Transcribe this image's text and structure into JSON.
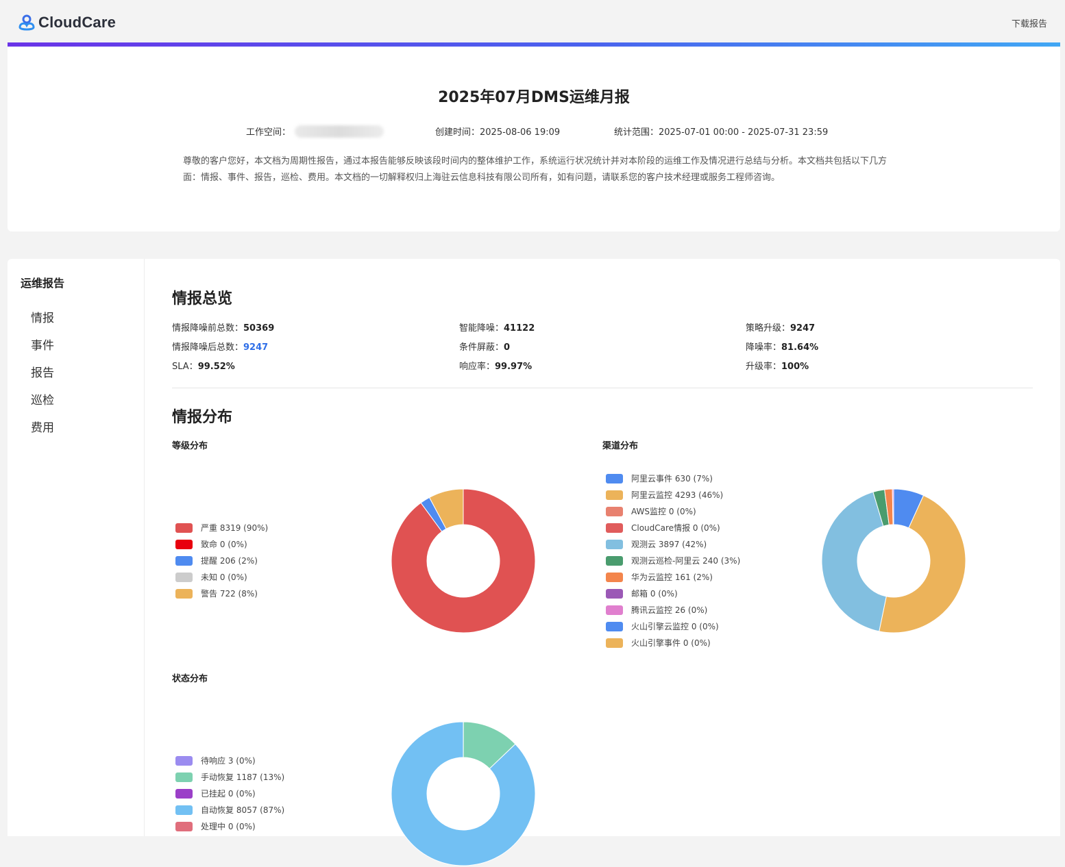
{
  "header": {
    "logo_text": "CloudCare",
    "download_label": "下载报告"
  },
  "report": {
    "title": "2025年07月DMS运维月报",
    "workspace_label": "工作空间：",
    "created_label": "创建时间：2025-08-06 19:09",
    "range_label": "统计范围：2025-07-01 00:00 - 2025-07-31 23:59",
    "intro": "尊敬的客户您好，本文档为周期性报告，通过本报告能够反映该段时间内的整体维护工作，系统运行状况统计并对本阶段的运维工作及情况进行总结与分析。本文档共包括以下几方面：情报、事件、报告，巡检、费用。本文档的一切解释权归上海驻云信息科技有限公司所有，如有问题，请联系您的客户技术经理或服务工程师咨询。"
  },
  "sidebar": {
    "title": "运维报告",
    "items": [
      {
        "label": "情报"
      },
      {
        "label": "事件"
      },
      {
        "label": "报告"
      },
      {
        "label": "巡检"
      },
      {
        "label": "费用"
      }
    ]
  },
  "overview": {
    "title": "情报总览",
    "stats": [
      {
        "label": "情报降噪前总数：",
        "value": "50369"
      },
      {
        "label": "智能降噪：",
        "value": "41122"
      },
      {
        "label": "策略升级：",
        "value": "9247"
      },
      {
        "label": "情报降噪后总数：",
        "value": "9247"
      },
      {
        "label": "条件屏蔽：",
        "value": "0"
      },
      {
        "label": "降噪率：",
        "value": "81.64%"
      },
      {
        "label": "SLA：",
        "value": "99.52%"
      },
      {
        "label": "响应率：",
        "value": "99.97%"
      },
      {
        "label": "升级率：",
        "value": "100%"
      }
    ],
    "highlight_color": "#2f6fe8"
  },
  "distribution": {
    "title": "情报分布"
  },
  "chart_data": [
    {
      "type": "pie",
      "title": "等级分布",
      "donut": true,
      "legend_position": "left",
      "categories": [
        "严重 8319 (90%)",
        "致命 0 (0%)",
        "提醒 206 (2%)",
        "未知 0 (0%)",
        "警告 722 (8%)"
      ],
      "values": [
        8319,
        0,
        206,
        0,
        722
      ],
      "colors": [
        "#e05252",
        "#e8000e",
        "#4f8bf0",
        "#cccccc",
        "#ecb35a"
      ]
    },
    {
      "type": "pie",
      "title": "渠道分布",
      "donut": true,
      "legend_position": "left",
      "categories": [
        "阿里云事件 630 (7%)",
        "阿里云监控 4293 (46%)",
        "AWS监控 0 (0%)",
        "CloudCare情报 0 (0%)",
        "观测云 3897 (42%)",
        "观测云巡检-阿里云 240 (3%)",
        "华为云监控 161 (2%)",
        "邮箱 0 (0%)",
        "腾讯云监控 26 (0%)",
        "火山引擎云监控 0 (0%)",
        "火山引擎事件 0 (0%)"
      ],
      "values": [
        630,
        4293,
        0,
        0,
        3897,
        240,
        161,
        0,
        26,
        0,
        0
      ],
      "colors": [
        "#4f8bf0",
        "#ecb35a",
        "#e8816f",
        "#e05c5c",
        "#82bfe0",
        "#4a9c6e",
        "#f3854c",
        "#9b59b6",
        "#e07fce",
        "#4f8bf0",
        "#ecb35a"
      ]
    },
    {
      "type": "pie",
      "title": "状态分布",
      "donut": true,
      "legend_position": "left",
      "categories": [
        "待响应 3 (0%)",
        "手动恢复 1187 (13%)",
        "已挂起 0 (0%)",
        "自动恢复 8057 (87%)",
        "处理中 0 (0%)"
      ],
      "values": [
        3,
        1187,
        0,
        8057,
        0
      ],
      "colors": [
        "#9b8cf0",
        "#7dd1b0",
        "#9b3fc8",
        "#72c0f3",
        "#e06e7c"
      ]
    }
  ]
}
